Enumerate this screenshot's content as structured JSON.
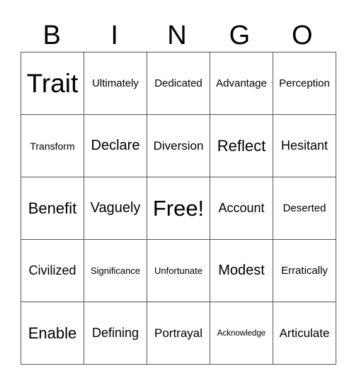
{
  "header": [
    "B",
    "I",
    "N",
    "G",
    "O"
  ],
  "rows": [
    [
      "Trait",
      "Ultimately",
      "Dedicated",
      "Advantage",
      "Perception"
    ],
    [
      "Transform",
      "Declare",
      "Diversion",
      "Reflect",
      "Hesitant"
    ],
    [
      "Benefit",
      "Vaguely",
      "Free!",
      "Account",
      "Deserted"
    ],
    [
      "Civilized",
      "Significance",
      "Unfortunate",
      "Modest",
      "Erratically"
    ],
    [
      "Enable",
      "Defining",
      "Portrayal",
      "Acknowledge",
      "Articulate"
    ]
  ]
}
